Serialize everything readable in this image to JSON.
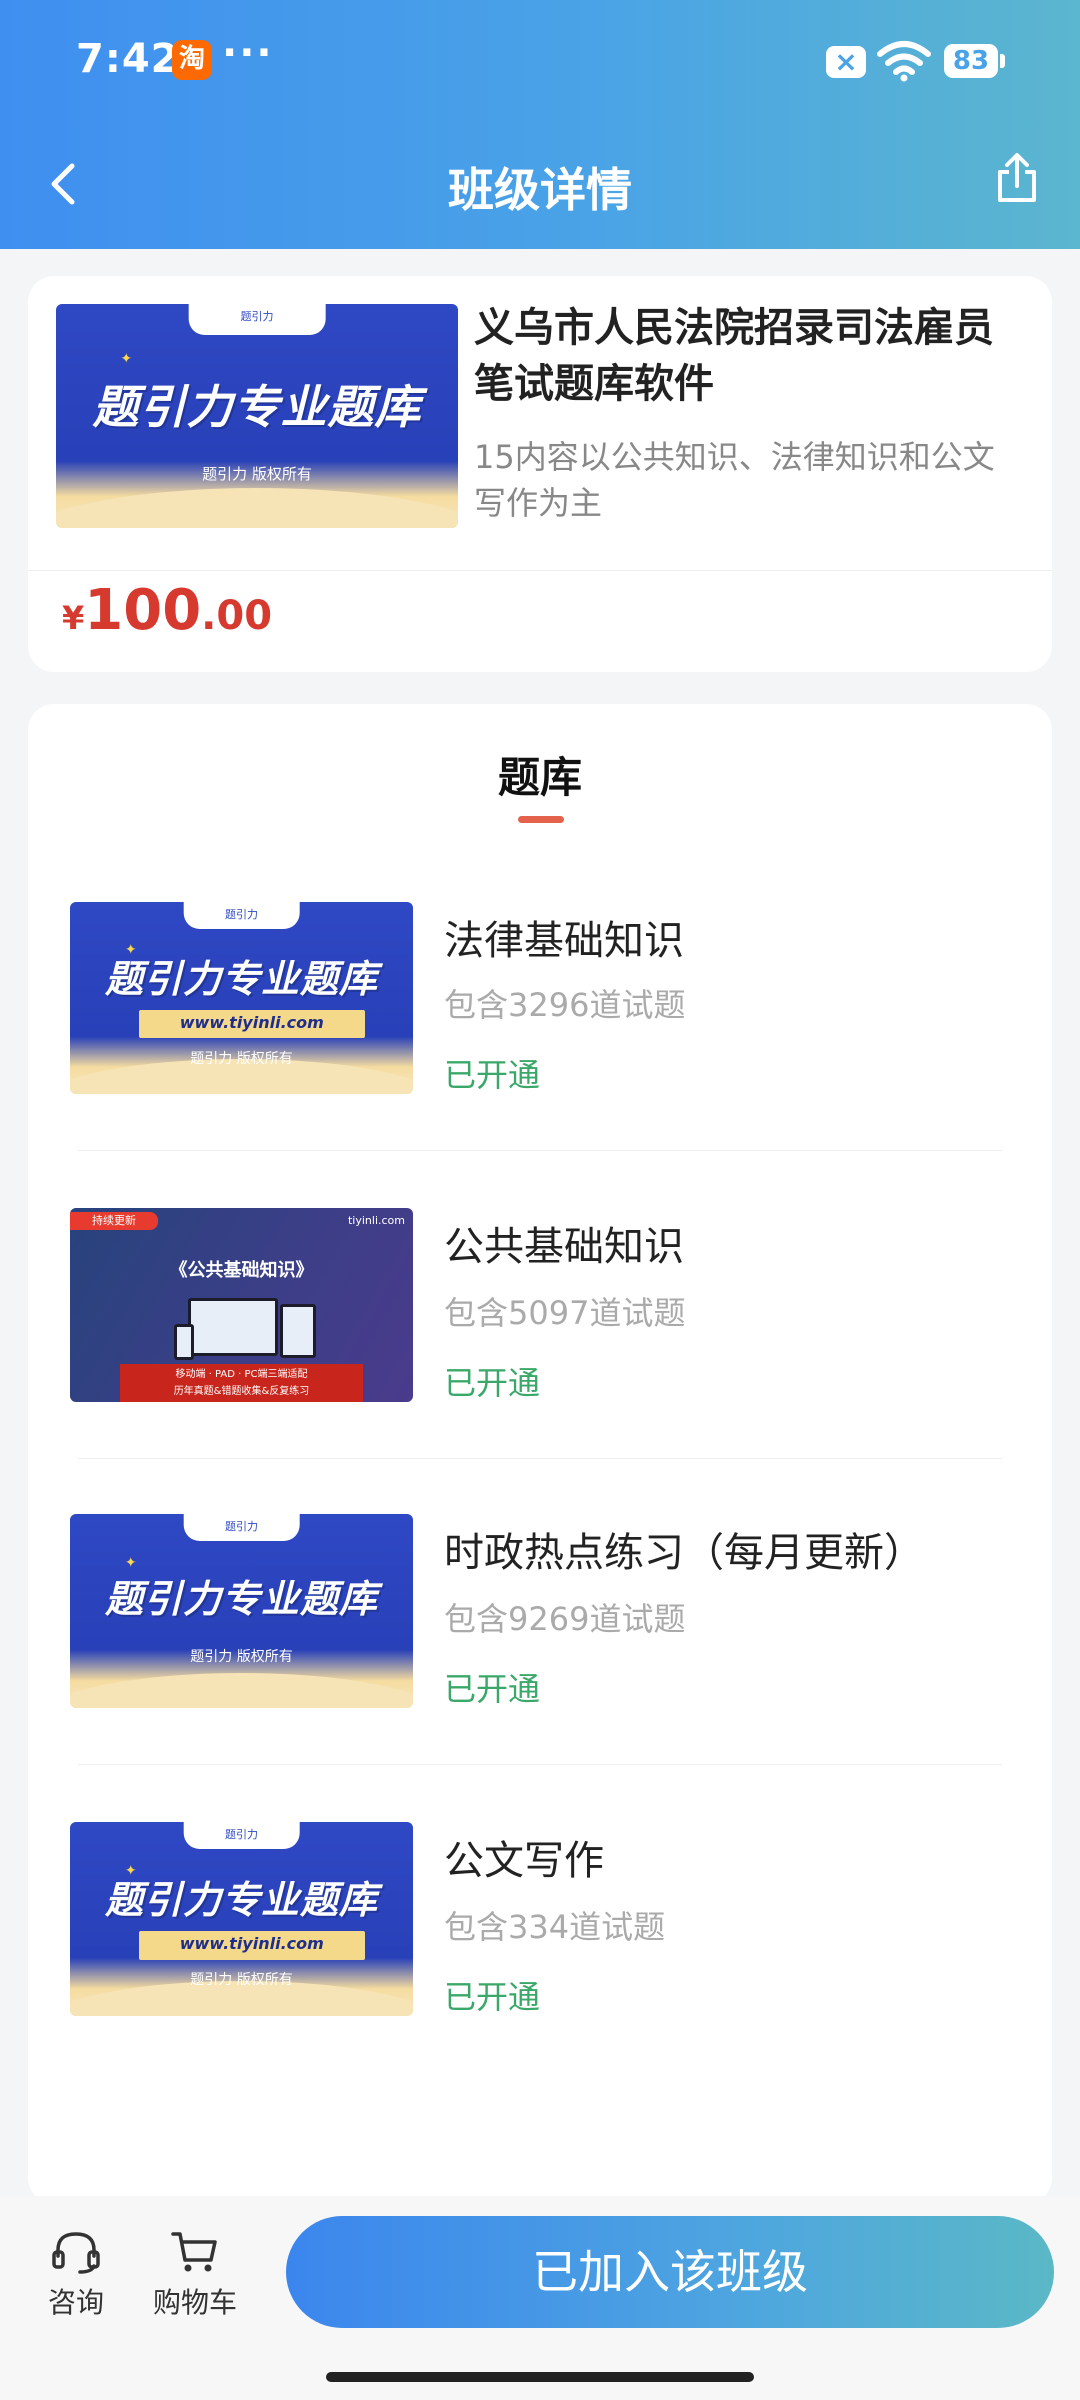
{
  "status_bar": {
    "time": "7:42",
    "app_badge": "淘",
    "dots": "···",
    "sim_label": "×",
    "battery": "83"
  },
  "header": {
    "title": "班级详情",
    "back_icon": "chevron-left-icon",
    "share_icon": "share-icon"
  },
  "course": {
    "thumb": {
      "tab": "题引力",
      "brand": "题引力专业题库",
      "copyright": "题引力 版权所有"
    },
    "title": "义乌市人民法院招录司法雇员笔试题库软件",
    "description": "15内容以公共知识、法律知识和公文写作为主",
    "price": {
      "currency": "¥",
      "integer": "100",
      "decimal": ".00"
    }
  },
  "question_bank": {
    "section_title": "题库",
    "items": [
      {
        "title": "法律基础知识",
        "count": "包含3296道试题",
        "status": "已开通",
        "thumb": {
          "tab": "题引力",
          "brand": "题引力专业题库",
          "url": "www.tiyinli.com",
          "copyright": "题引力 版权所有"
        }
      },
      {
        "title": "公共基础知识",
        "count": "包含5097道试题",
        "status": "已开通",
        "thumb": {
          "badge": "持续更新",
          "logo": "tiyinli.com",
          "title": "《公共基础知识》",
          "line1": "移动端 · PAD · PC端三端适配",
          "line2": "历年真题&错题收集&反复练习"
        }
      },
      {
        "title": "时政热点练习（每月更新）",
        "count": "包含9269道试题",
        "status": "已开通",
        "thumb": {
          "tab": "题引力",
          "brand": "题引力专业题库",
          "copyright": "题引力 版权所有"
        }
      },
      {
        "title": "公文写作",
        "count": "包含334道试题",
        "status": "已开通",
        "thumb": {
          "tab": "题引力",
          "brand": "题引力专业题库",
          "url": "www.tiyinli.com",
          "copyright": "题引力 版权所有"
        }
      }
    ]
  },
  "bottom_bar": {
    "consult_label": "咨询",
    "cart_label": "购物车",
    "join_button": "已加入该班级"
  },
  "colors": {
    "header_gradient_start": "#3f8ff0",
    "header_gradient_end": "#5bb6cf",
    "price": "#d63a2f",
    "status_green": "#3ba86a",
    "section_underline": "#e4614b"
  }
}
